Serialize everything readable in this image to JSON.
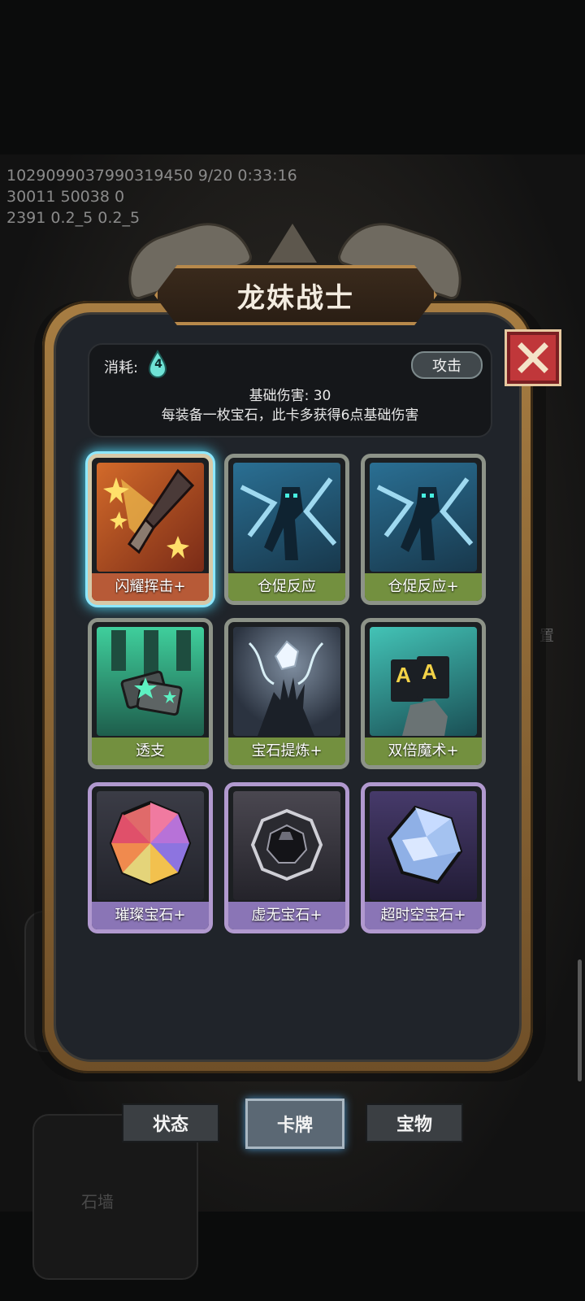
{
  "debug": {
    "line1": "1029099037990319450 9/20 0:33:16",
    "line2": "30011 50038 0",
    "line3": "2391 0.2_5 0.2_5"
  },
  "background": {
    "left_label": "石墙",
    "right_label": "置"
  },
  "dialog": {
    "title": "龙妹战士",
    "close_icon": "close-x-icon",
    "info": {
      "cost_label": "消耗:",
      "cost_value": "4",
      "tag": "攻击",
      "base_damage": "基础伤害: 30",
      "description": "每装备一枚宝石，此卡多获得6点基础伤害"
    },
    "cards": [
      {
        "name": "闪耀挥击+",
        "rarity": "orange",
        "icon": "dagger-sparkle-icon",
        "selected": true
      },
      {
        "name": "仓促反应",
        "rarity": "green",
        "icon": "runner-figure-icon",
        "selected": false
      },
      {
        "name": "仓促反应+",
        "rarity": "green",
        "icon": "runner-figure-icon",
        "selected": false
      },
      {
        "name": "透支",
        "rarity": "green",
        "icon": "card-stack-icon",
        "selected": false
      },
      {
        "name": "宝石提炼+",
        "rarity": "green",
        "icon": "hand-crystal-icon",
        "selected": false
      },
      {
        "name": "双倍魔术+",
        "rarity": "green",
        "icon": "double-ace-icon",
        "selected": false
      },
      {
        "name": "璀璨宝石+",
        "rarity": "purple",
        "icon": "rainbow-gem-icon",
        "selected": false
      },
      {
        "name": "虚无宝石+",
        "rarity": "purple",
        "icon": "void-gem-icon",
        "selected": false
      },
      {
        "name": "超时空宝石+",
        "rarity": "purple",
        "icon": "time-gem-icon",
        "selected": false
      }
    ]
  },
  "tabs": [
    {
      "label": "状态",
      "active": false
    },
    {
      "label": "卡牌",
      "active": true
    },
    {
      "label": "宝物",
      "active": false
    }
  ],
  "colors": {
    "frame_gold": "#a77d42",
    "close_red": "#c0373a",
    "selected_glow": "#4ccbe8",
    "orange_banner": "#b75a37",
    "green_banner": "#73903f",
    "purple_banner": "#8a75b6"
  }
}
